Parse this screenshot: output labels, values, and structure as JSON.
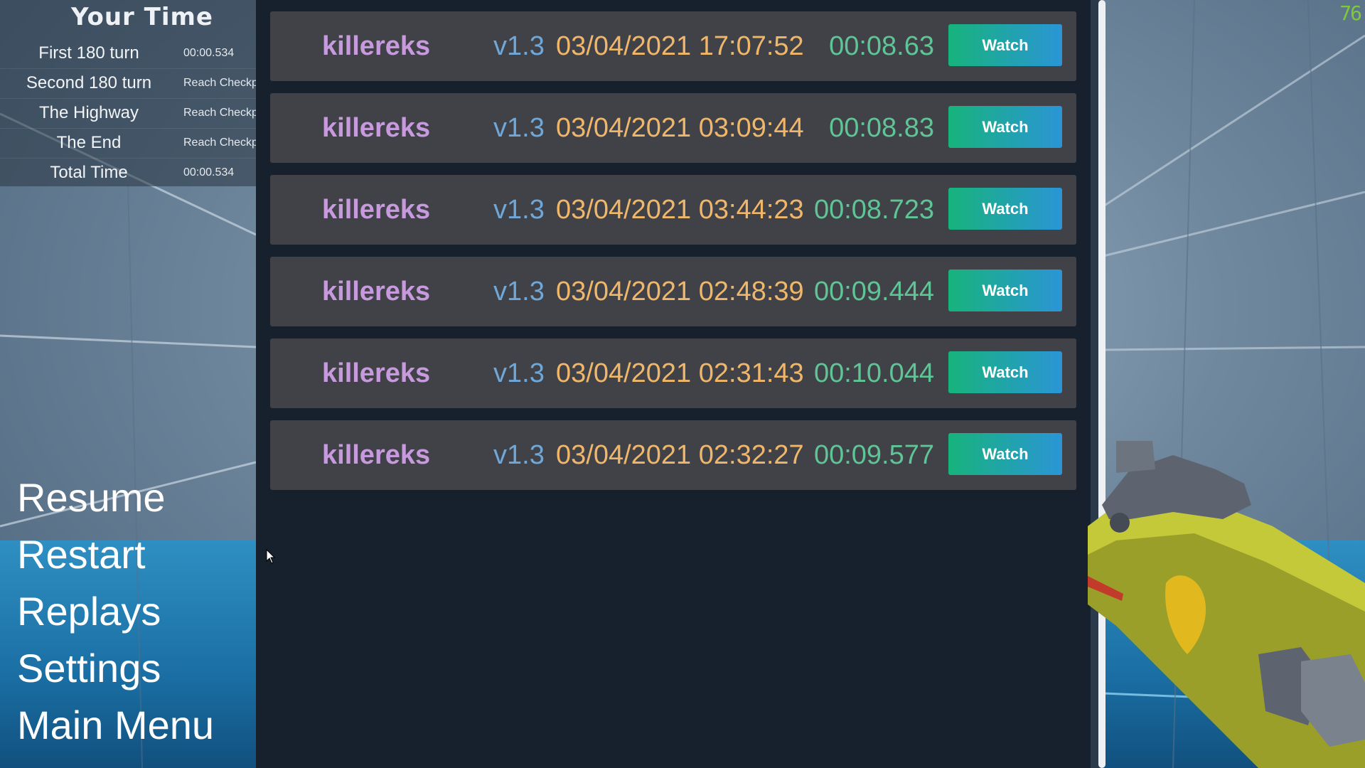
{
  "splits": {
    "title": "Your Time",
    "rows": [
      {
        "name": "First 180 turn",
        "time": "00:00.534"
      },
      {
        "name": "Second 180 turn",
        "time": "Reach Checkp"
      },
      {
        "name": "The Highway",
        "time": "Reach Checkp"
      },
      {
        "name": "The End",
        "time": "Reach Checkp"
      },
      {
        "name": "Total Time",
        "time": "00:00.534"
      }
    ]
  },
  "menu": {
    "items": [
      "Resume",
      "Restart",
      "Replays",
      "Settings",
      "Main Menu"
    ]
  },
  "replays": {
    "watch_label": "Watch",
    "rows": [
      {
        "player": "killereks",
        "version": "v1.3",
        "date": "03/04/2021 17:07:52",
        "time": "00:08.63"
      },
      {
        "player": "killereks",
        "version": "v1.3",
        "date": "03/04/2021 03:09:44",
        "time": "00:08.83"
      },
      {
        "player": "killereks",
        "version": "v1.3",
        "date": "03/04/2021 03:44:23",
        "time": "00:08.723"
      },
      {
        "player": "killereks",
        "version": "v1.3",
        "date": "03/04/2021 02:48:39",
        "time": "00:09.444"
      },
      {
        "player": "killereks",
        "version": "v1.3",
        "date": "03/04/2021 02:31:43",
        "time": "00:10.044"
      },
      {
        "player": "killereks",
        "version": "v1.3",
        "date": "03/04/2021 02:32:27",
        "time": "00:09.577"
      }
    ]
  },
  "fps": "76",
  "icons": {
    "cursor": "mouse-pointer-icon",
    "weapon": "rocket-launcher-icon"
  },
  "colors": {
    "panel_bg": "#17212d",
    "row_bg": "#404247",
    "player": "#c79ade",
    "version": "#6fa7d8",
    "date": "#f0b76a",
    "time": "#5fc597",
    "watch_start": "#17b37c",
    "watch_end": "#2a95d6",
    "fps": "#7ec83a"
  }
}
